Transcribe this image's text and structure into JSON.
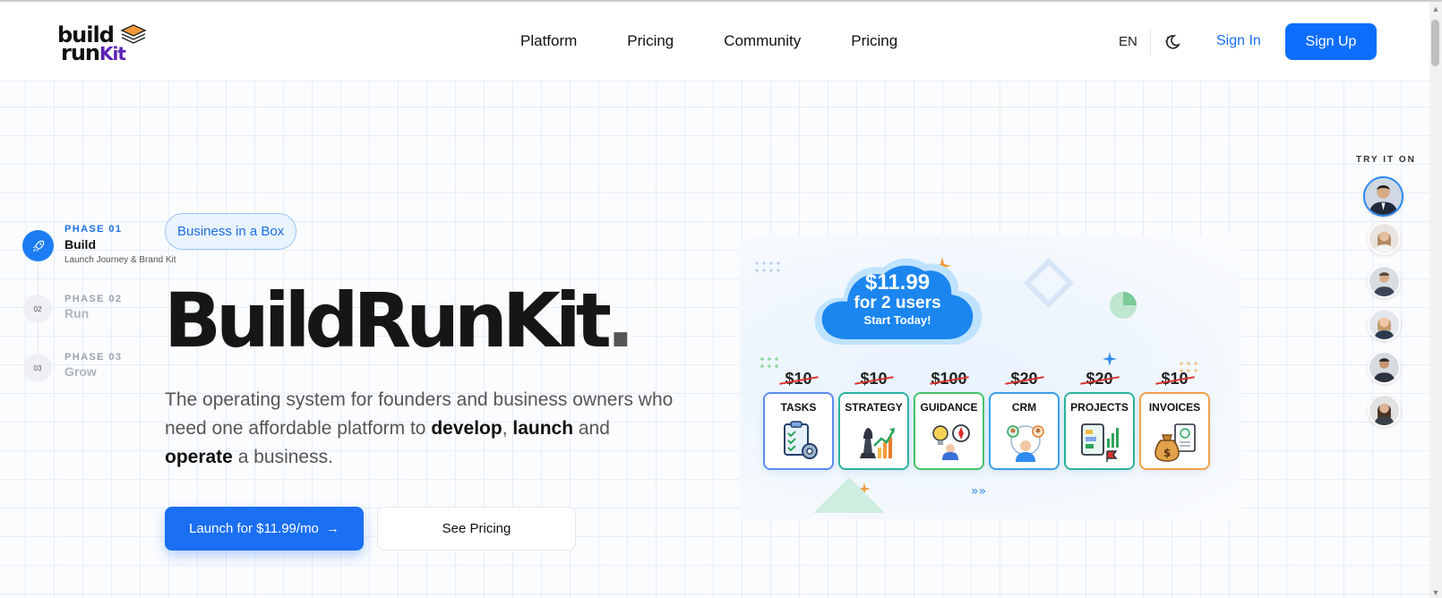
{
  "header": {
    "logo": {
      "line1": "build",
      "line2": "run",
      "kit": "Kit"
    },
    "nav": [
      {
        "label": "Platform"
      },
      {
        "label": "Pricing"
      },
      {
        "label": "Community"
      },
      {
        "label": "Pricing"
      }
    ],
    "lang": "EN",
    "sign_in": "Sign In",
    "sign_up": "Sign Up"
  },
  "phases": [
    {
      "kicker": "PHASE 01",
      "title": "Build",
      "subtitle": "Launch Journey & Brand Kit",
      "num": ""
    },
    {
      "kicker": "PHASE 02",
      "title": "Run",
      "num": "02"
    },
    {
      "kicker": "PHASE 03",
      "title": "Grow",
      "num": "03"
    }
  ],
  "hero": {
    "badge": "Business in a Box",
    "headline": "BuildRunKit",
    "headline_dot": ".",
    "desc": {
      "part1": "The operating system for founders and business owners who need one affordable platform to ",
      "b1": "develop",
      "part2": ", ",
      "b2": "launch",
      "part3": " and ",
      "b3": "operate",
      "part4": " a business."
    },
    "cta_primary": "Launch for $11.99/mo",
    "cta_secondary": "See Pricing"
  },
  "promo": {
    "price": "$11.99",
    "users": "for 2 users",
    "start": "Start Today!",
    "cards": [
      {
        "old_price": "$10",
        "title": "TASKS",
        "icon": "clipboard-gear-icon",
        "color": "#5b8def"
      },
      {
        "old_price": "$10",
        "title": "STRATEGY",
        "icon": "chess-growth-icon",
        "color": "#2bb3a3"
      },
      {
        "old_price": "$100",
        "title": "GUIDANCE",
        "icon": "bulb-compass-icon",
        "color": "#44c36a"
      },
      {
        "old_price": "$20",
        "title": "CRM",
        "icon": "people-network-icon",
        "color": "#3aa0e8"
      },
      {
        "old_price": "$20",
        "title": "PROJECTS",
        "icon": "kanban-flag-icon",
        "color": "#2bb39a"
      },
      {
        "old_price": "$10",
        "title": "INVOICES",
        "icon": "money-invoice-icon",
        "color": "#f0a24a"
      }
    ]
  },
  "try_it_on": {
    "label": "TRY IT ON",
    "avatars": [
      {
        "name": "avatar-1",
        "selected": true
      },
      {
        "name": "avatar-2"
      },
      {
        "name": "avatar-3"
      },
      {
        "name": "avatar-4"
      },
      {
        "name": "avatar-5"
      },
      {
        "name": "avatar-6"
      }
    ]
  },
  "colors": {
    "primary": "#1a6ff2",
    "text": "#111111",
    "muted": "#555555",
    "badge_bg": "#eaf4ff"
  }
}
